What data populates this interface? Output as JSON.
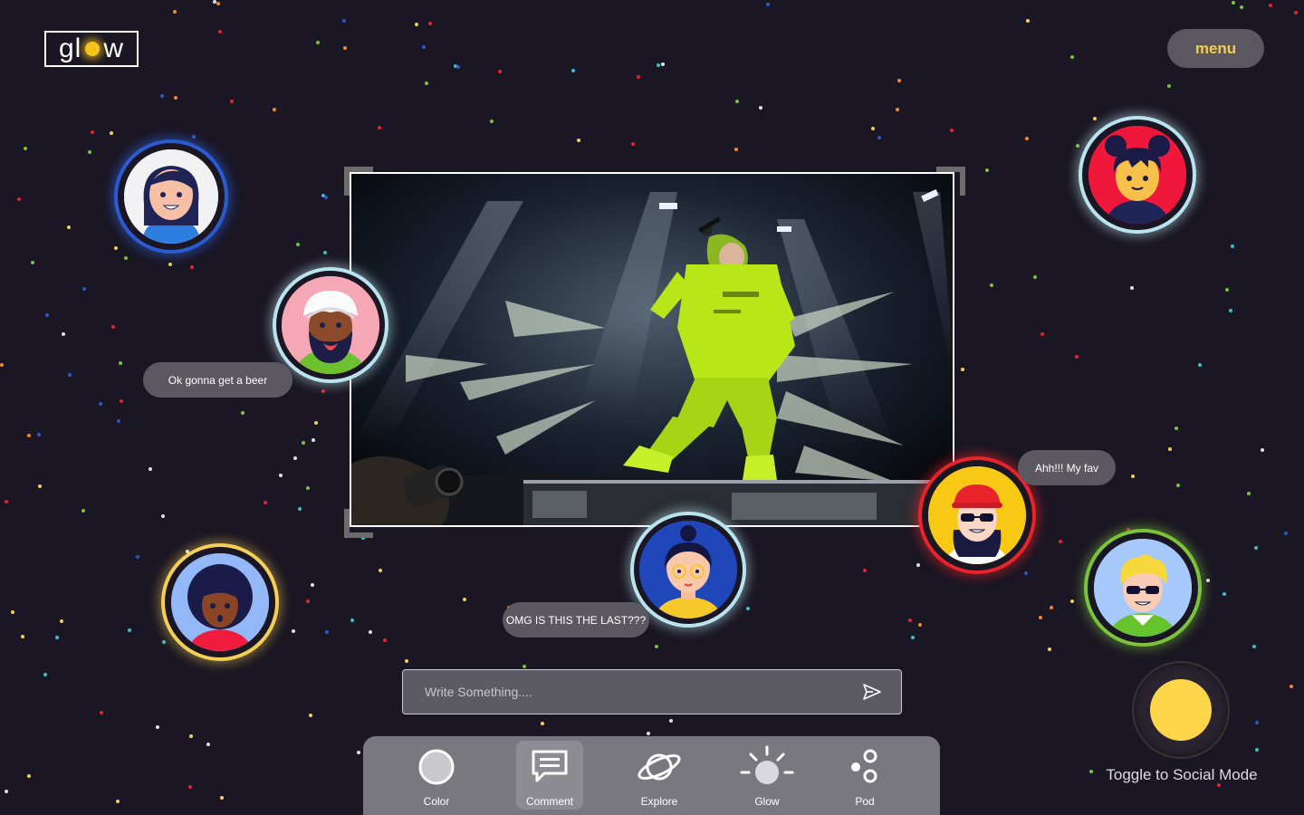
{
  "app": {
    "logo_prefix": "gl",
    "logo_suffix": "w",
    "menu_label": "menu"
  },
  "chat": {
    "bubble_beer": "Ok gonna get a beer",
    "bubble_fav": "Ahh!!! My fav",
    "bubble_omg": "OMG IS THIS THE LAST???"
  },
  "composer": {
    "placeholder": "Write Something...."
  },
  "toolbar": {
    "items": [
      {
        "label": "Color",
        "icon": "color-circle-icon"
      },
      {
        "label": "Comment",
        "icon": "comment-icon",
        "active": true
      },
      {
        "label": "Explore",
        "icon": "planet-icon"
      },
      {
        "label": "Glow",
        "icon": "sun-icon"
      },
      {
        "label": "Pod",
        "icon": "pod-dots-icon"
      }
    ]
  },
  "social": {
    "toggle_label": "Toggle to Social Mode"
  },
  "colors": {
    "background": "#1a1623",
    "accent_yellow": "#ffd54a",
    "menu_text": "#f2cf47",
    "bubble": "#5b5861",
    "toolbar": "#7a787f"
  }
}
